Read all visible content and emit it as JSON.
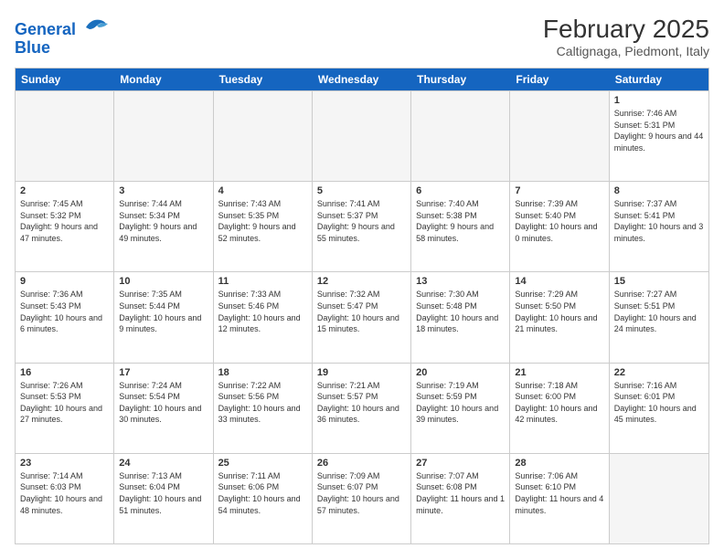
{
  "header": {
    "logo_line1": "General",
    "logo_line2": "Blue",
    "month": "February 2025",
    "location": "Caltignaga, Piedmont, Italy"
  },
  "weekdays": [
    "Sunday",
    "Monday",
    "Tuesday",
    "Wednesday",
    "Thursday",
    "Friday",
    "Saturday"
  ],
  "rows": [
    [
      {
        "day": "",
        "info": ""
      },
      {
        "day": "",
        "info": ""
      },
      {
        "day": "",
        "info": ""
      },
      {
        "day": "",
        "info": ""
      },
      {
        "day": "",
        "info": ""
      },
      {
        "day": "",
        "info": ""
      },
      {
        "day": "1",
        "info": "Sunrise: 7:46 AM\nSunset: 5:31 PM\nDaylight: 9 hours and 44 minutes."
      }
    ],
    [
      {
        "day": "2",
        "info": "Sunrise: 7:45 AM\nSunset: 5:32 PM\nDaylight: 9 hours and 47 minutes."
      },
      {
        "day": "3",
        "info": "Sunrise: 7:44 AM\nSunset: 5:34 PM\nDaylight: 9 hours and 49 minutes."
      },
      {
        "day": "4",
        "info": "Sunrise: 7:43 AM\nSunset: 5:35 PM\nDaylight: 9 hours and 52 minutes."
      },
      {
        "day": "5",
        "info": "Sunrise: 7:41 AM\nSunset: 5:37 PM\nDaylight: 9 hours and 55 minutes."
      },
      {
        "day": "6",
        "info": "Sunrise: 7:40 AM\nSunset: 5:38 PM\nDaylight: 9 hours and 58 minutes."
      },
      {
        "day": "7",
        "info": "Sunrise: 7:39 AM\nSunset: 5:40 PM\nDaylight: 10 hours and 0 minutes."
      },
      {
        "day": "8",
        "info": "Sunrise: 7:37 AM\nSunset: 5:41 PM\nDaylight: 10 hours and 3 minutes."
      }
    ],
    [
      {
        "day": "9",
        "info": "Sunrise: 7:36 AM\nSunset: 5:43 PM\nDaylight: 10 hours and 6 minutes."
      },
      {
        "day": "10",
        "info": "Sunrise: 7:35 AM\nSunset: 5:44 PM\nDaylight: 10 hours and 9 minutes."
      },
      {
        "day": "11",
        "info": "Sunrise: 7:33 AM\nSunset: 5:46 PM\nDaylight: 10 hours and 12 minutes."
      },
      {
        "day": "12",
        "info": "Sunrise: 7:32 AM\nSunset: 5:47 PM\nDaylight: 10 hours and 15 minutes."
      },
      {
        "day": "13",
        "info": "Sunrise: 7:30 AM\nSunset: 5:48 PM\nDaylight: 10 hours and 18 minutes."
      },
      {
        "day": "14",
        "info": "Sunrise: 7:29 AM\nSunset: 5:50 PM\nDaylight: 10 hours and 21 minutes."
      },
      {
        "day": "15",
        "info": "Sunrise: 7:27 AM\nSunset: 5:51 PM\nDaylight: 10 hours and 24 minutes."
      }
    ],
    [
      {
        "day": "16",
        "info": "Sunrise: 7:26 AM\nSunset: 5:53 PM\nDaylight: 10 hours and 27 minutes."
      },
      {
        "day": "17",
        "info": "Sunrise: 7:24 AM\nSunset: 5:54 PM\nDaylight: 10 hours and 30 minutes."
      },
      {
        "day": "18",
        "info": "Sunrise: 7:22 AM\nSunset: 5:56 PM\nDaylight: 10 hours and 33 minutes."
      },
      {
        "day": "19",
        "info": "Sunrise: 7:21 AM\nSunset: 5:57 PM\nDaylight: 10 hours and 36 minutes."
      },
      {
        "day": "20",
        "info": "Sunrise: 7:19 AM\nSunset: 5:59 PM\nDaylight: 10 hours and 39 minutes."
      },
      {
        "day": "21",
        "info": "Sunrise: 7:18 AM\nSunset: 6:00 PM\nDaylight: 10 hours and 42 minutes."
      },
      {
        "day": "22",
        "info": "Sunrise: 7:16 AM\nSunset: 6:01 PM\nDaylight: 10 hours and 45 minutes."
      }
    ],
    [
      {
        "day": "23",
        "info": "Sunrise: 7:14 AM\nSunset: 6:03 PM\nDaylight: 10 hours and 48 minutes."
      },
      {
        "day": "24",
        "info": "Sunrise: 7:13 AM\nSunset: 6:04 PM\nDaylight: 10 hours and 51 minutes."
      },
      {
        "day": "25",
        "info": "Sunrise: 7:11 AM\nSunset: 6:06 PM\nDaylight: 10 hours and 54 minutes."
      },
      {
        "day": "26",
        "info": "Sunrise: 7:09 AM\nSunset: 6:07 PM\nDaylight: 10 hours and 57 minutes."
      },
      {
        "day": "27",
        "info": "Sunrise: 7:07 AM\nSunset: 6:08 PM\nDaylight: 11 hours and 1 minute."
      },
      {
        "day": "28",
        "info": "Sunrise: 7:06 AM\nSunset: 6:10 PM\nDaylight: 11 hours and 4 minutes."
      },
      {
        "day": "",
        "info": ""
      }
    ]
  ]
}
